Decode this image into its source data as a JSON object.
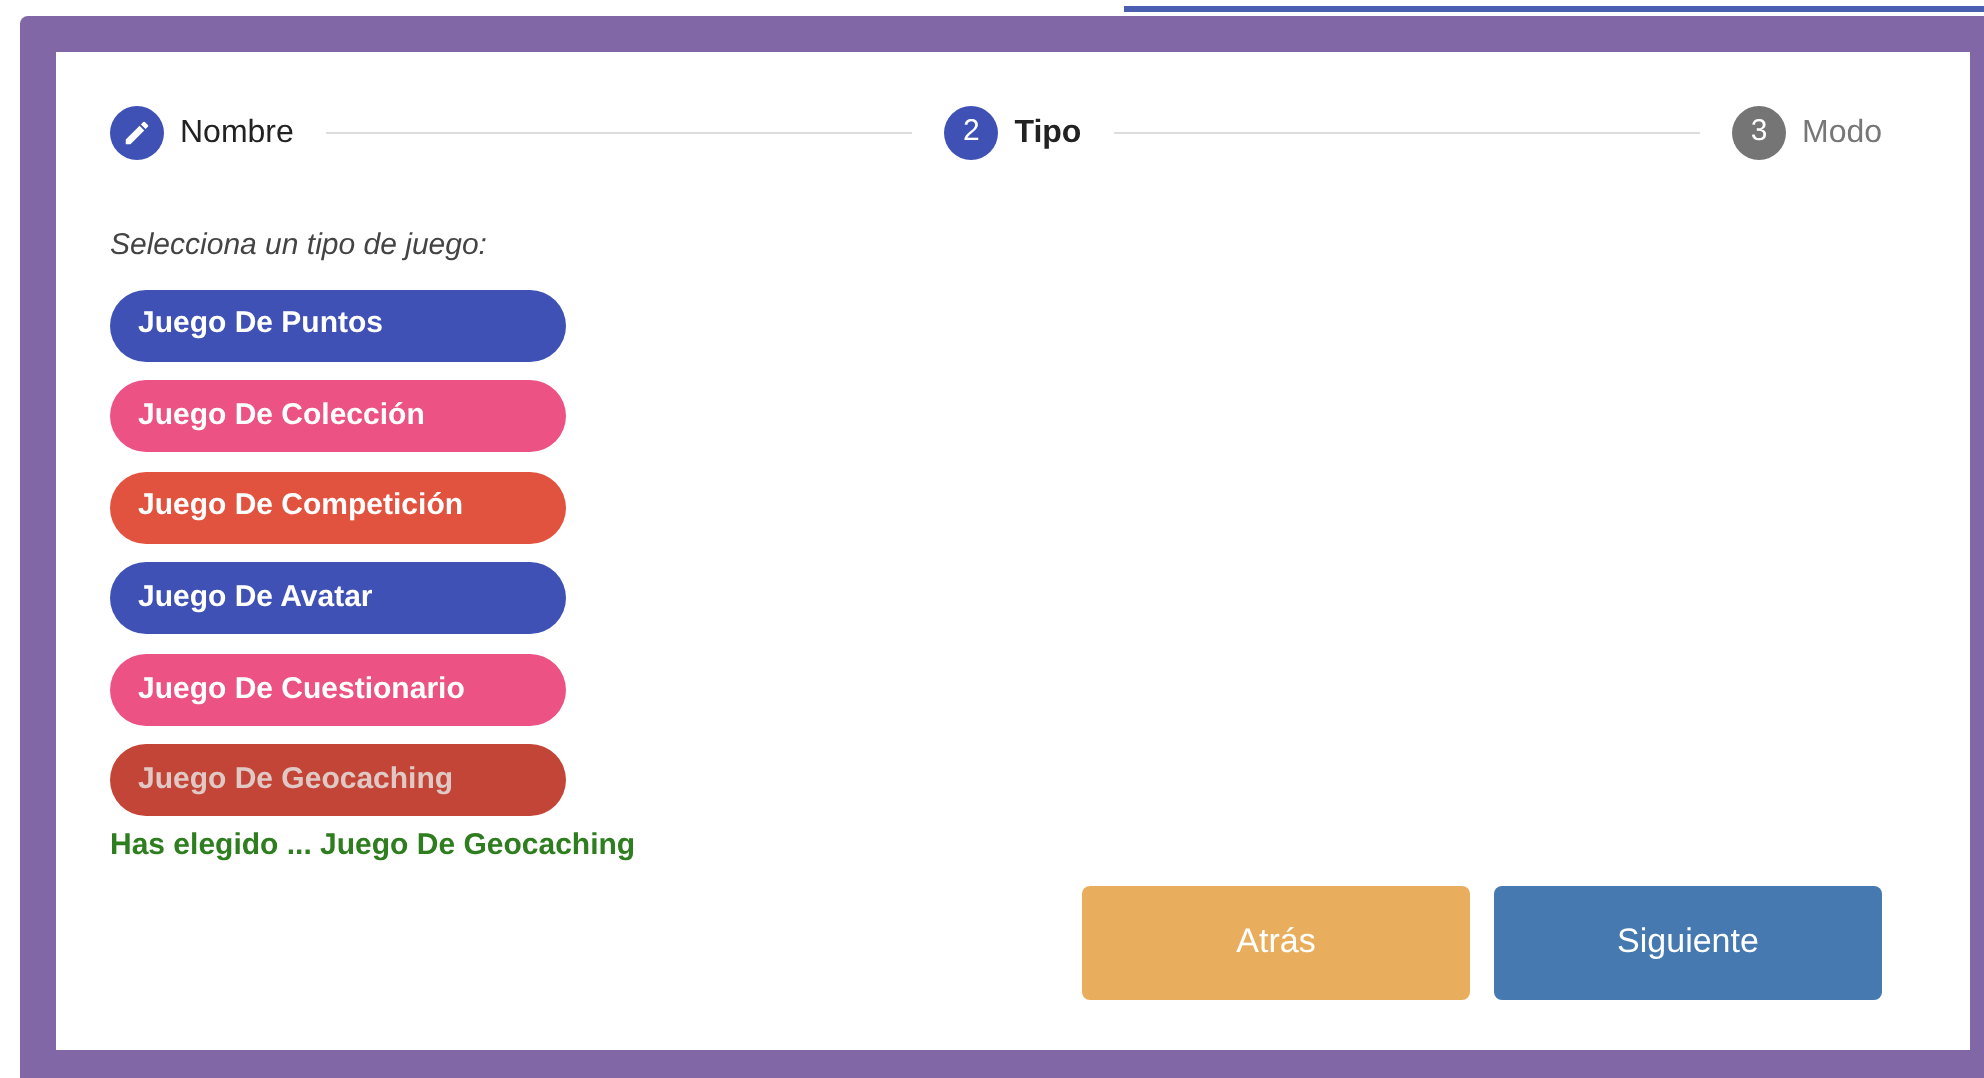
{
  "steps": [
    {
      "label": "Nombre",
      "completed": true,
      "selected": false
    },
    {
      "number": "2",
      "label": "Tipo",
      "completed": false,
      "selected": true
    },
    {
      "number": "3",
      "label": "Modo",
      "completed": false,
      "selected": false
    }
  ],
  "prompt": "Selecciona un tipo de juego:",
  "game_types": [
    {
      "label": "Juego De Puntos",
      "color": "#3f51b5",
      "selected": false
    },
    {
      "label": "Juego De Colección",
      "color": "#ec5284",
      "selected": false
    },
    {
      "label": "Juego De Competición",
      "color": "#e2533f",
      "selected": false
    },
    {
      "label": "Juego De Avatar",
      "color": "#3f51b5",
      "selected": false
    },
    {
      "label": "Juego De Cuestionario",
      "color": "#ec5284",
      "selected": false
    },
    {
      "label": "Juego De Geocaching",
      "color": "#c24537",
      "selected": true
    }
  ],
  "choice_message": "Has elegido ... Juego De Geocaching",
  "buttons": [
    {
      "label": "Atrás",
      "kind": "back"
    },
    {
      "label": "Siguiente",
      "kind": "next"
    }
  ]
}
